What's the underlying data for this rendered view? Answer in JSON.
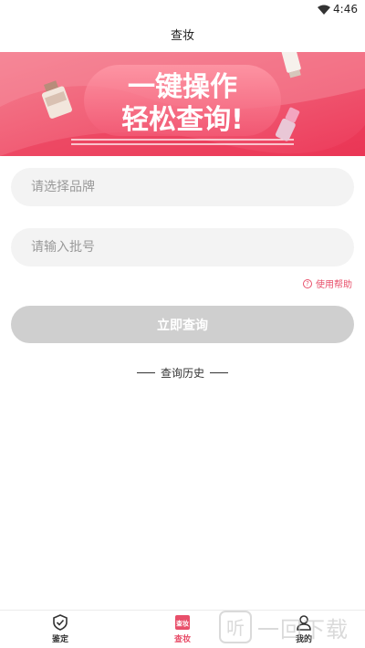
{
  "status": {
    "time": "4:46"
  },
  "header": {
    "title": "查妆"
  },
  "banner": {
    "line1": "一键操作",
    "line2": "轻松查询!"
  },
  "form": {
    "brand_placeholder": "请选择品牌",
    "batch_placeholder": "请输入批号",
    "help_label": "使用帮助",
    "submit_label": "立即查询"
  },
  "history": {
    "label": "查询历史"
  },
  "tabs": [
    {
      "label": "鉴定",
      "icon": "shield-check-icon"
    },
    {
      "label": "查妆",
      "icon": "query-tile-icon",
      "icon_text": "查妆"
    },
    {
      "label": "我的",
      "icon": "user-icon"
    }
  ],
  "watermark": {
    "text": "一回下载"
  },
  "colors": {
    "accent": "#e84f6a",
    "banner_start": "#f26d7d",
    "banner_end": "#ee3f5f",
    "button_disabled": "#cfcfcf",
    "field_bg": "#f3f3f3"
  }
}
